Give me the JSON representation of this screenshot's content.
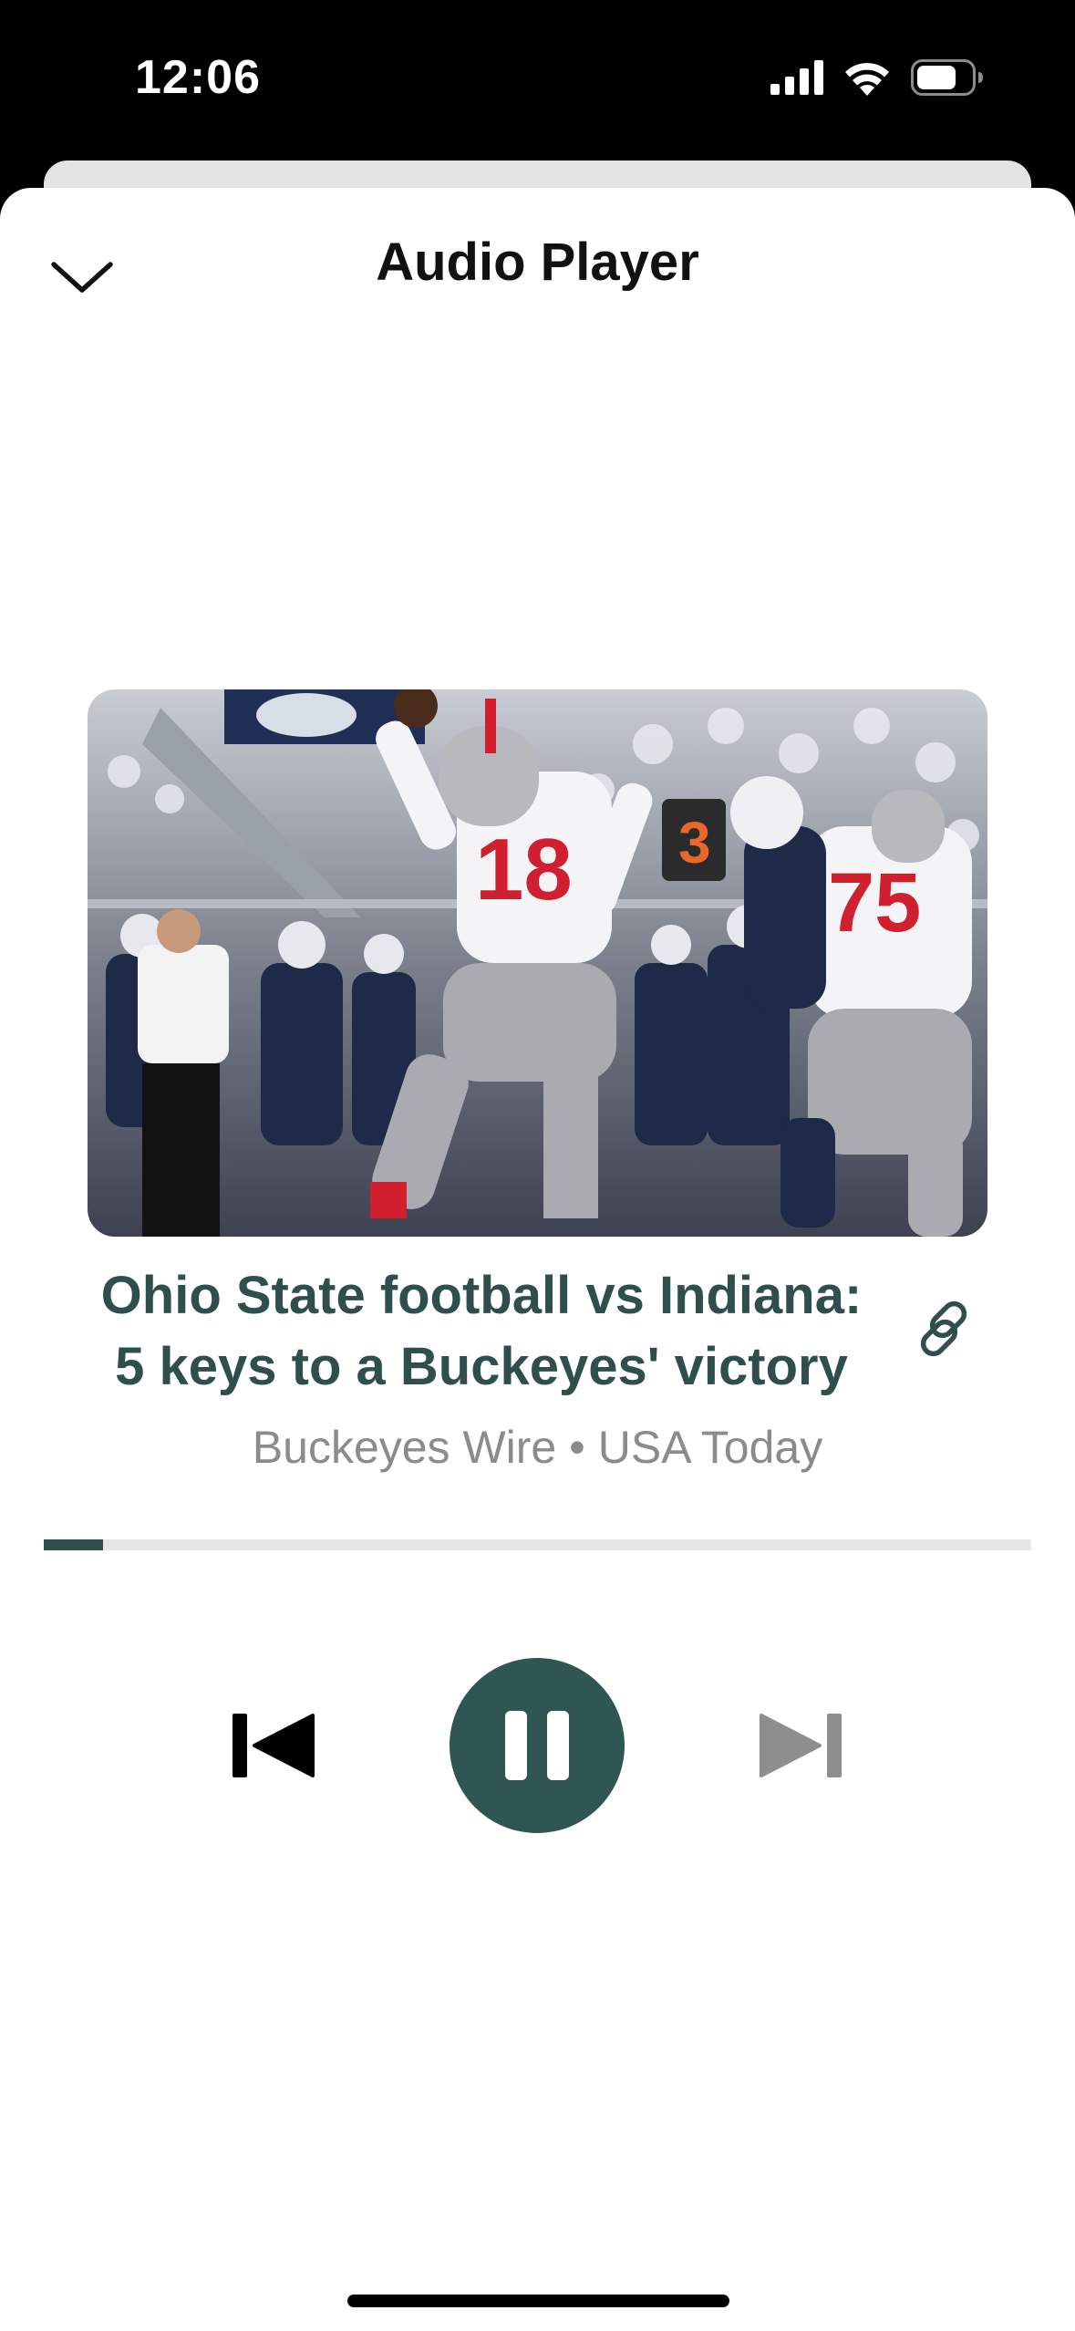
{
  "status_bar": {
    "time": "12:06",
    "icons": [
      "cellular-signal-icon",
      "wifi-icon",
      "battery-icon"
    ]
  },
  "header": {
    "title": "Audio Player",
    "close_icon": "chevron-down-icon"
  },
  "article": {
    "image_description_icon": "football-photo",
    "headline": "Ohio State football vs Indiana: 5 keys to a Buckeyes' victory",
    "source_name": "Buckeyes Wire",
    "separator": "•",
    "publisher": "USA Today",
    "link_icon": "link-icon"
  },
  "playback": {
    "progress_percent": 6,
    "state": "playing"
  },
  "controls": {
    "previous_icon": "skip-back-icon",
    "play_pause_icon": "pause-icon",
    "next_icon": "skip-forward-icon"
  },
  "colors": {
    "accent": "#2f4f4c",
    "play_button": "#2f5652",
    "secondary_text": "#8b8b8b",
    "disabled_icon": "#8e8e8e"
  }
}
